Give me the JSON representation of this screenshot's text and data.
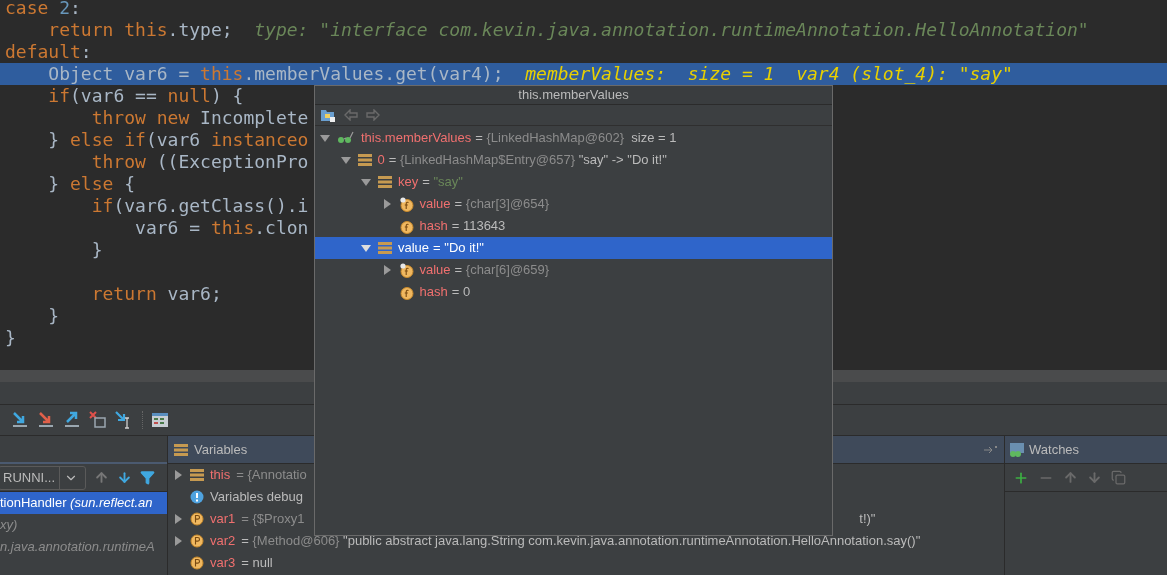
{
  "editor": {
    "lines": [
      {
        "kind": "code",
        "selected": false,
        "segments": [
          {
            "kind": "kw",
            "text": "case "
          },
          {
            "kind": "num",
            "text": "2"
          },
          {
            "kind": "plain",
            "text": ":"
          }
        ]
      },
      {
        "kind": "code",
        "selected": false,
        "segments": [
          {
            "kind": "kw",
            "text": "    return this"
          },
          {
            "kind": "plain",
            "text": ".type;"
          },
          {
            "kind": "hint",
            "text": "  type: \"interface com.kevin.java.annotation.runtimeAnnotation.HelloAnnotation\""
          }
        ]
      },
      {
        "kind": "code",
        "selected": false,
        "segments": [
          {
            "kind": "kw",
            "text": "default"
          },
          {
            "kind": "plain",
            "text": ":"
          }
        ]
      },
      {
        "kind": "code",
        "selected": true,
        "segments": [
          {
            "kind": "plain",
            "text": "    Object var6 = "
          },
          {
            "kind": "kw",
            "text": "this"
          },
          {
            "kind": "plain",
            "text": ".memberValues.get(var4);"
          },
          {
            "kind": "hint",
            "text": "  memberValues:  size = 1  var4 (slot_4): \"say\""
          }
        ]
      },
      {
        "kind": "code",
        "selected": false,
        "segments": [
          {
            "kind": "kw",
            "text": "    if"
          },
          {
            "kind": "plain",
            "text": "(var6 == "
          },
          {
            "kind": "kw",
            "text": "null"
          },
          {
            "kind": "plain",
            "text": ") {"
          }
        ]
      },
      {
        "kind": "code",
        "selected": false,
        "segments": [
          {
            "kind": "kw",
            "text": "        throw new"
          },
          {
            "kind": "plain",
            "text": " Incomplete"
          }
        ]
      },
      {
        "kind": "code",
        "selected": false,
        "segments": [
          {
            "kind": "plain",
            "text": "    } "
          },
          {
            "kind": "kw",
            "text": "else if"
          },
          {
            "kind": "plain",
            "text": "(var6 "
          },
          {
            "kind": "kw",
            "text": "instanceo"
          }
        ]
      },
      {
        "kind": "code",
        "selected": false,
        "segments": [
          {
            "kind": "kw",
            "text": "        throw"
          },
          {
            "kind": "plain",
            "text": " ((ExceptionPro"
          }
        ]
      },
      {
        "kind": "code",
        "selected": false,
        "segments": [
          {
            "kind": "plain",
            "text": "    } "
          },
          {
            "kind": "kw",
            "text": "else"
          },
          {
            "kind": "plain",
            "text": " {"
          }
        ]
      },
      {
        "kind": "code",
        "selected": false,
        "segments": [
          {
            "kind": "kw",
            "text": "        if"
          },
          {
            "kind": "plain",
            "text": "(var6.getClass().i"
          }
        ]
      },
      {
        "kind": "code",
        "selected": false,
        "segments": [
          {
            "kind": "plain",
            "text": "            var6 = "
          },
          {
            "kind": "kw",
            "text": "this"
          },
          {
            "kind": "plain",
            "text": ".clon"
          }
        ]
      },
      {
        "kind": "code",
        "selected": false,
        "segments": [
          {
            "kind": "plain",
            "text": "        }"
          }
        ]
      },
      {
        "kind": "blank"
      },
      {
        "kind": "code",
        "selected": false,
        "segments": [
          {
            "kind": "kw",
            "text": "        return"
          },
          {
            "kind": "plain",
            "text": " var6;"
          }
        ]
      },
      {
        "kind": "code",
        "selected": false,
        "segments": [
          {
            "kind": "plain",
            "text": "    }"
          }
        ]
      },
      {
        "kind": "code",
        "selected": false,
        "segments": [
          {
            "kind": "plain",
            "text": "}"
          }
        ]
      }
    ]
  },
  "frames": {
    "thread": "RUNNI...",
    "rows": [
      {
        "method": "tionHandler",
        "location": " (sun.reflect.an",
        "selected": true
      },
      {
        "location": "xy)",
        "selected": false
      },
      {
        "location": "n.java.annotation.runtimeA",
        "selected": false
      }
    ]
  },
  "variables": {
    "title": "Variables",
    "rows": [
      {
        "kind": "object",
        "expanded": false,
        "name": "this",
        "value": [
          {
            "kind": "ref",
            "text": "= {Annotatio"
          }
        ]
      },
      {
        "kind": "info",
        "message": "Variables debug"
      },
      {
        "kind": "param",
        "expanded": false,
        "name": "var1",
        "value": [
          {
            "kind": "ref",
            "text": "= {$Proxy1"
          }
        ],
        "value_end": "t!)\""
      },
      {
        "kind": "param",
        "expanded": false,
        "name": "var2",
        "value": [
          {
            "kind": "plain",
            "text": "= "
          },
          {
            "kind": "ref",
            "text": "{Method@606}"
          },
          {
            "kind": "plain",
            "text": " \"public abstract java.lang.String com.kevin.java.annotation.runtimeAnnotation.HelloAnnotation.say()\""
          }
        ]
      },
      {
        "kind": "param",
        "name": "var3",
        "value": [
          {
            "kind": "plain",
            "text": "= null"
          }
        ]
      }
    ]
  },
  "watches": {
    "title": "Watches"
  },
  "popup": {
    "title": "this.memberValues",
    "tree": [
      {
        "kind": "watch",
        "name": "this.memberValues",
        "expanded": true,
        "selected": false,
        "value": [
          {
            "kind": "plain",
            "text": "= "
          },
          {
            "kind": "ref",
            "text": "{LinkedHashMap@602}"
          },
          {
            "kind": "plain",
            "text": "  size = 1"
          }
        ],
        "children": [
          {
            "kind": "object",
            "name": "0",
            "expanded": true,
            "selected": false,
            "value": [
              {
                "kind": "plain",
                "text": "= "
              },
              {
                "kind": "ref",
                "text": "{LinkedHashMap$Entry@657}"
              },
              {
                "kind": "plain",
                "text": " \"say\" -> \"Do it!\""
              }
            ],
            "children": [
              {
                "kind": "object",
                "name": "key",
                "expanded": true,
                "selected": false,
                "value": [
                  {
                    "kind": "plain",
                    "text": "= "
                  },
                  {
                    "kind": "string",
                    "text": "\"say\""
                  }
                ],
                "children": [
                  {
                    "kind": "final",
                    "name": "value",
                    "expanded": false,
                    "selected": false,
                    "value": [
                      {
                        "kind": "plain",
                        "text": "= "
                      },
                      {
                        "kind": "ref",
                        "text": "{char[3]@654}"
                      }
                    ]
                  },
                  {
                    "kind": "field",
                    "name": "hash",
                    "selected": false,
                    "value": [
                      {
                        "kind": "plain",
                        "text": "= 113643"
                      }
                    ]
                  }
                ]
              },
              {
                "kind": "object",
                "name": "value",
                "expanded": true,
                "selected": true,
                "value": [
                  {
                    "kind": "plain",
                    "text": "= \"Do it!\""
                  }
                ],
                "children": [
                  {
                    "kind": "final",
                    "name": "value",
                    "expanded": false,
                    "selected": false,
                    "value": [
                      {
                        "kind": "plain",
                        "text": "= "
                      },
                      {
                        "kind": "ref",
                        "text": "{char[6]@659}"
                      }
                    ]
                  },
                  {
                    "kind": "field",
                    "name": "hash",
                    "selected": false,
                    "value": [
                      {
                        "kind": "plain",
                        "text": "= 0"
                      }
                    ]
                  }
                ]
              }
            ]
          }
        ]
      }
    ]
  }
}
